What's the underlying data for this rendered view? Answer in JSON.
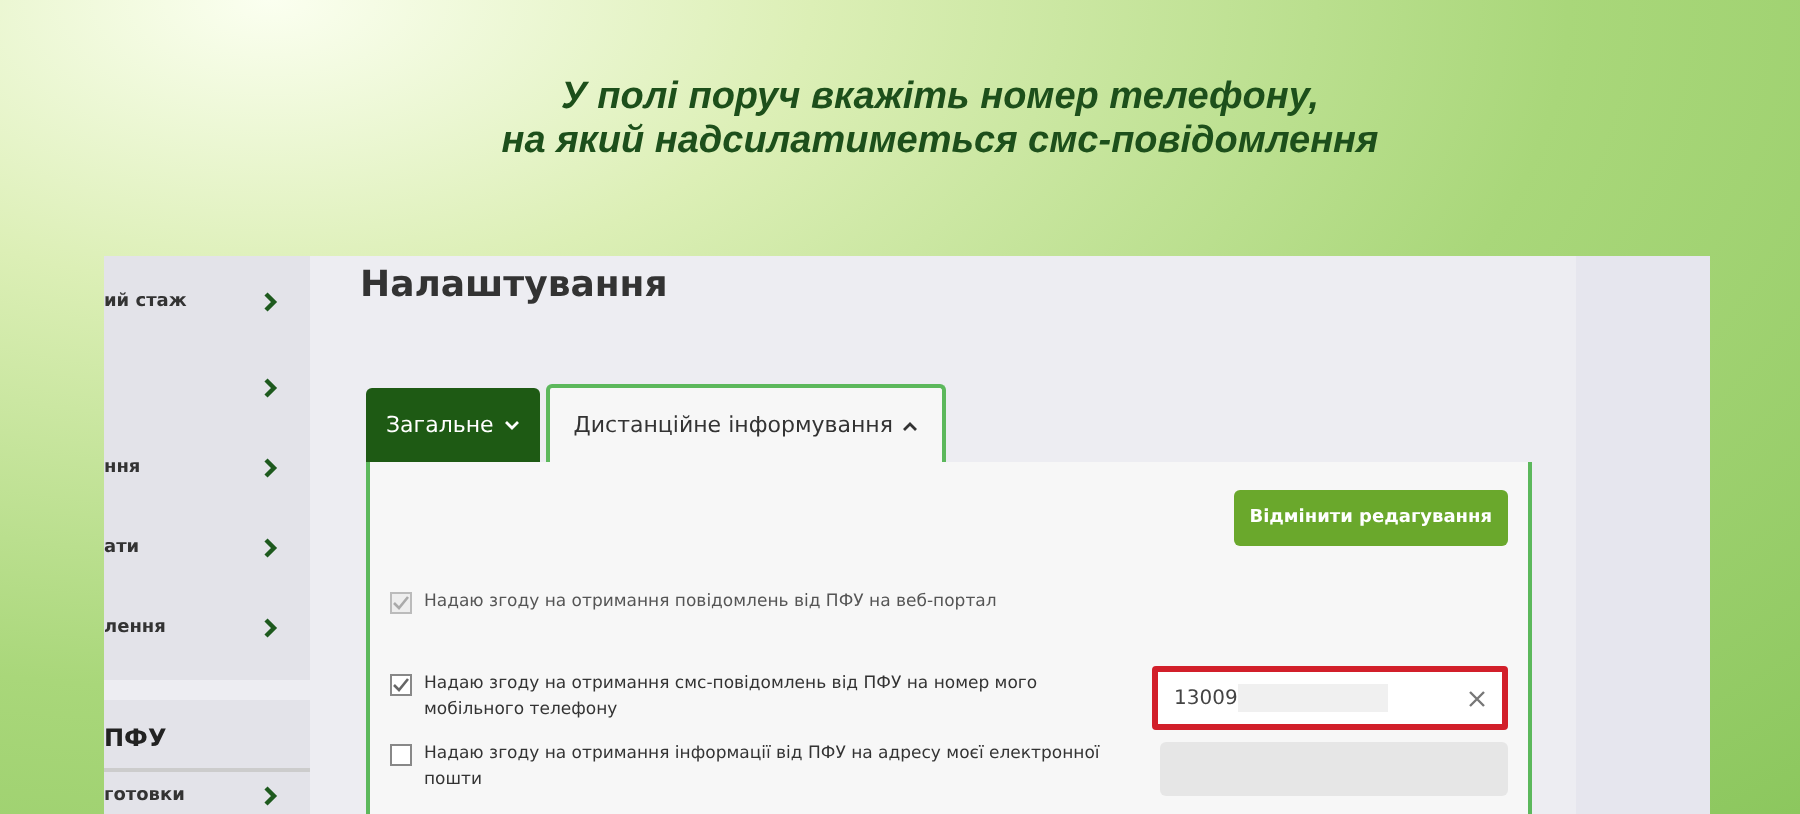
{
  "caption": [
    "У полі поруч вкажіть номер телефону,",
    "на який надсилатиметься смс-повідомлення"
  ],
  "sidebar": {
    "items": [
      {
        "label": "ий стаж",
        "kind": "link"
      },
      {
        "kind": "link"
      },
      {
        "label": "ння",
        "kind": "link"
      },
      {
        "label": "ати",
        "kind": "link"
      },
      {
        "label": "лення",
        "kind": "link"
      }
    ],
    "section_title": "ПФУ",
    "section_items": [
      {
        "label": "готовки",
        "kind": "link"
      }
    ]
  },
  "settings": {
    "title": "Налаштування",
    "tabs": [
      {
        "label": "Загальне",
        "selected": false
      },
      {
        "label": "Дистанційне інформування",
        "selected": true
      }
    ],
    "cancel_button": "Відмінити редагування",
    "options": [
      {
        "label": "Надаю згоду на отримання повідомлень від ПФУ на веб-портал",
        "checked": true,
        "disabled": true
      },
      {
        "label": "Надаю згоду на отримання смс-повідомлень від ПФУ на номер мого мобільного телефону",
        "checked": true,
        "disabled": false,
        "field": {
          "value": "13009",
          "disabled": false,
          "highlighted": true
        }
      },
      {
        "label": "Надаю згоду на отримання інформації від ПФУ на адресу моєї електронної пошти",
        "checked": false,
        "disabled": false,
        "field": {
          "disabled": true,
          "highlighted": false
        }
      }
    ]
  }
}
